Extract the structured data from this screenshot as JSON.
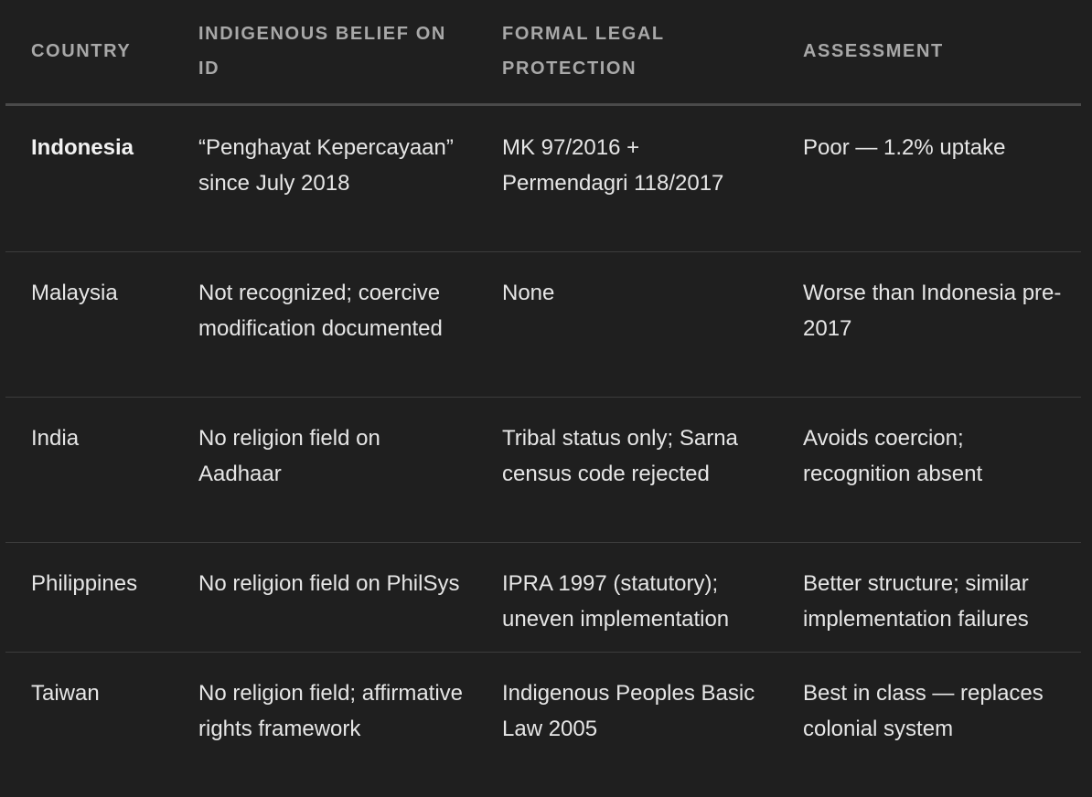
{
  "table": {
    "headers": [
      "COUNTRY",
      "INDIGENOUS BELIEF ON ID",
      "FORMAL LEGAL PROTECTION",
      "ASSESSMENT"
    ],
    "rows": [
      {
        "country": "Indonesia",
        "belief_on_id": "“Penghayat Kepercayaan” since July 2018",
        "legal_protection": "MK 97/2016 + Permendagri 118/2017",
        "assessment": "Poor — 1.2% uptake"
      },
      {
        "country": "Malaysia",
        "belief_on_id": "Not recognized; coercive modification documented",
        "legal_protection": "None",
        "assessment": "Worse than Indonesia pre-2017"
      },
      {
        "country": "India",
        "belief_on_id": "No religion field on Aadhaar",
        "legal_protection": "Tribal status only; Sarna census code rejected",
        "assessment": "Avoids coercion; recognition absent"
      },
      {
        "country": "Philippines",
        "belief_on_id": "No religion field on PhilSys",
        "legal_protection": "IPRA 1997 (statutory); uneven implementation",
        "assessment": "Better structure; similar implementation failures"
      },
      {
        "country": "Taiwan",
        "belief_on_id": "No religion field; affirmative rights framework",
        "legal_protection": "Indigenous Peoples Basic Law 2005",
        "assessment": "Best in class — replaces colonial system"
      }
    ]
  }
}
